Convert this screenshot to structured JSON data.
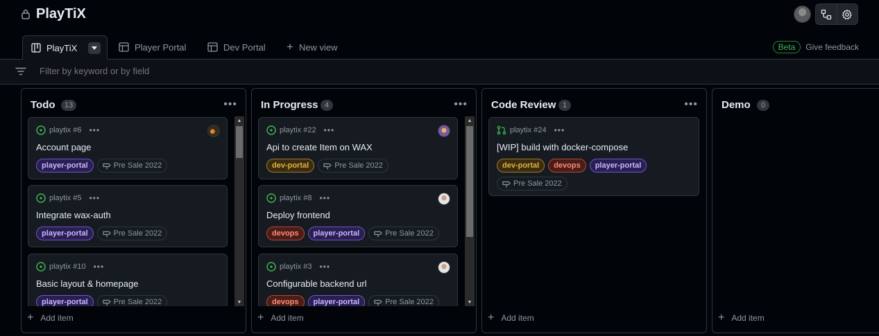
{
  "header": {
    "title": "PlayTiX"
  },
  "tabs": [
    {
      "label": "PlayTiX",
      "active": true
    },
    {
      "label": "Player Portal"
    },
    {
      "label": "Dev Portal"
    },
    {
      "label": "New view"
    }
  ],
  "feedback": {
    "badge": "Beta",
    "link": "Give feedback"
  },
  "filter": {
    "placeholder": "Filter by keyword or by field"
  },
  "add_item_label": "Add item",
  "columns": [
    {
      "title": "Todo",
      "count": "13",
      "cards": [
        {
          "ref": "playtix #6",
          "title": "Account page",
          "labels": [
            "player-portal"
          ],
          "milestone": "Pre Sale 2022",
          "status": "open"
        },
        {
          "ref": "playtix #5",
          "title": "Integrate wax-auth",
          "labels": [
            "player-portal"
          ],
          "milestone": "Pre Sale 2022",
          "status": "open"
        },
        {
          "ref": "playtix #10",
          "title": "Basic layout & homepage",
          "labels": [
            "player-portal"
          ],
          "milestone": "Pre Sale 2022",
          "status": "open"
        }
      ]
    },
    {
      "title": "In Progress",
      "count": "4",
      "cards": [
        {
          "ref": "playtix #22",
          "title": "Api to create Item on WAX",
          "labels": [
            "dev-portal"
          ],
          "milestone": "Pre Sale 2022",
          "status": "open"
        },
        {
          "ref": "playtix #8",
          "title": "Deploy frontend",
          "labels": [
            "devops",
            "player-portal"
          ],
          "milestone": "Pre Sale 2022",
          "status": "open"
        },
        {
          "ref": "playtix #3",
          "title": "Configurable backend url",
          "labels": [
            "devops",
            "player-portal"
          ],
          "milestone": "Pre Sale 2022",
          "status": "open"
        }
      ]
    },
    {
      "title": "Code Review",
      "count": "1",
      "cards": [
        {
          "ref": "playtix #24",
          "title": "[WIP] build with docker-compose",
          "labels": [
            "dev-portal",
            "devops",
            "player-portal"
          ],
          "milestone": "Pre Sale 2022",
          "status": "pull-request"
        }
      ]
    },
    {
      "title": "Demo",
      "count": "0",
      "cards": []
    }
  ],
  "colors": {
    "open": "#3fb950",
    "accent": "#238636",
    "background": "#010409"
  }
}
